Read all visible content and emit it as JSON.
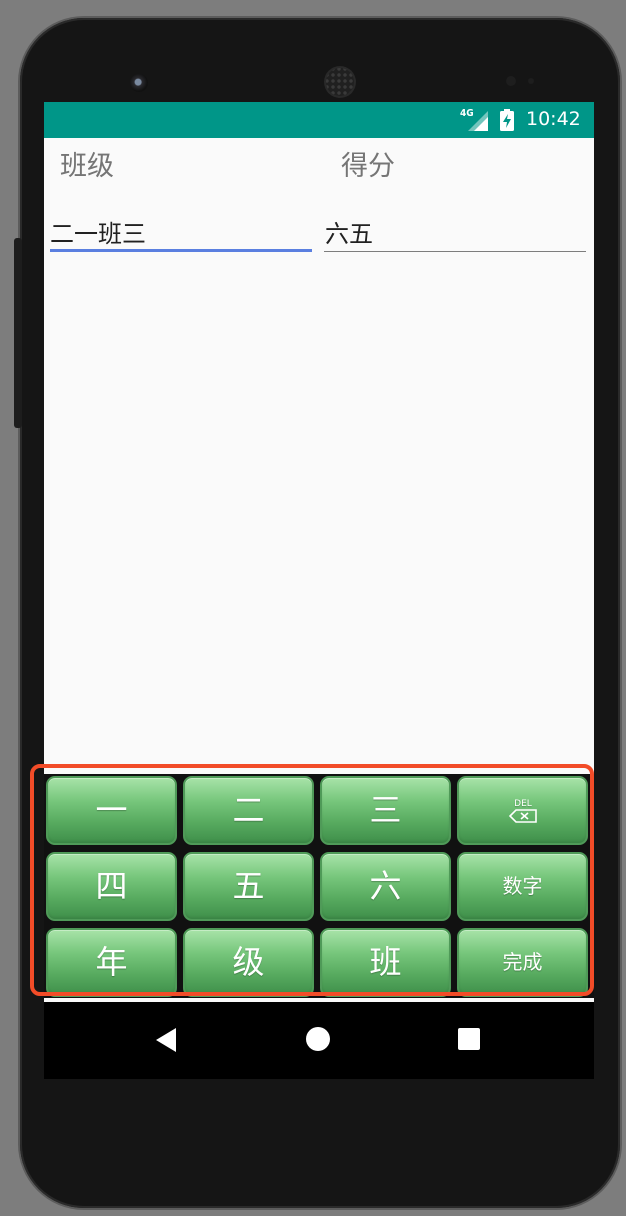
{
  "status_bar": {
    "network": "4G",
    "time": "10:42",
    "signal_icon": "signal-icon",
    "battery_icon": "battery-charging-icon",
    "color": "#009688"
  },
  "form": {
    "class_label": "班级",
    "score_label": "得分",
    "class_value": "二一班三",
    "score_value": "六五"
  },
  "keyboard": {
    "keys": [
      [
        "一",
        "二",
        "三",
        "DEL"
      ],
      [
        "四",
        "五",
        "六",
        "数字"
      ],
      [
        "年",
        "级",
        "班",
        "完成"
      ]
    ],
    "delete_icon": "backspace-icon",
    "key_color": "#5fb463"
  },
  "nav_bar": {
    "back_icon": "back-icon",
    "home_icon": "home-icon",
    "recents_icon": "recents-icon"
  },
  "highlight": {
    "color": "#f24c28"
  }
}
